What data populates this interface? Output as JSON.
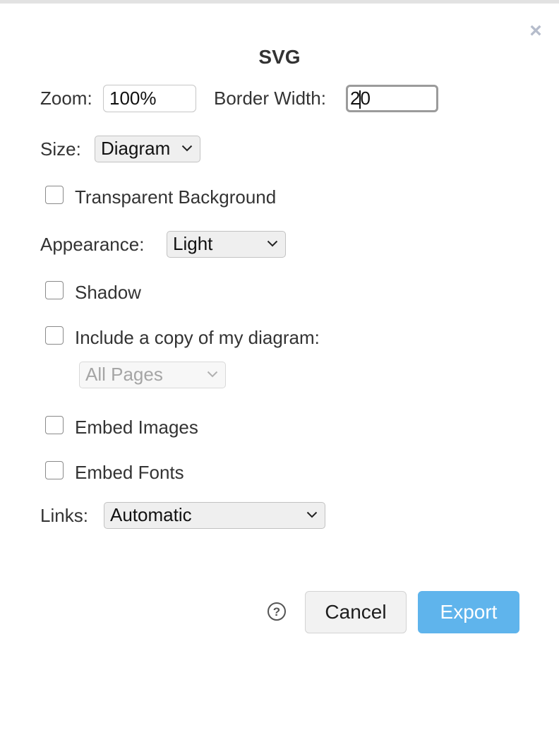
{
  "dialog": {
    "title": "SVG",
    "close_icon": "×"
  },
  "zoom": {
    "label": "Zoom:",
    "value": "100%"
  },
  "border_width": {
    "label": "Border Width:",
    "value_before_caret": "2",
    "value_after_caret": "0"
  },
  "size": {
    "label": "Size:",
    "selected": "Diagram"
  },
  "transparent_background": {
    "label": "Transparent Background",
    "checked": false
  },
  "appearance": {
    "label": "Appearance:",
    "selected": "Light"
  },
  "shadow": {
    "label": "Shadow",
    "checked": false
  },
  "include_copy": {
    "label": "Include a copy of my diagram:",
    "checked": false,
    "pages_selected": "All Pages",
    "pages_disabled": true
  },
  "embed_images": {
    "label": "Embed Images",
    "checked": false
  },
  "embed_fonts": {
    "label": "Embed Fonts",
    "checked": false
  },
  "links": {
    "label": "Links:",
    "selected": "Automatic"
  },
  "footer": {
    "help_icon": "?",
    "cancel_label": "Cancel",
    "export_label": "Export"
  },
  "colors": {
    "export_button": "#5fb4ec",
    "close_icon": "#b5bccb",
    "text": "#333333"
  }
}
